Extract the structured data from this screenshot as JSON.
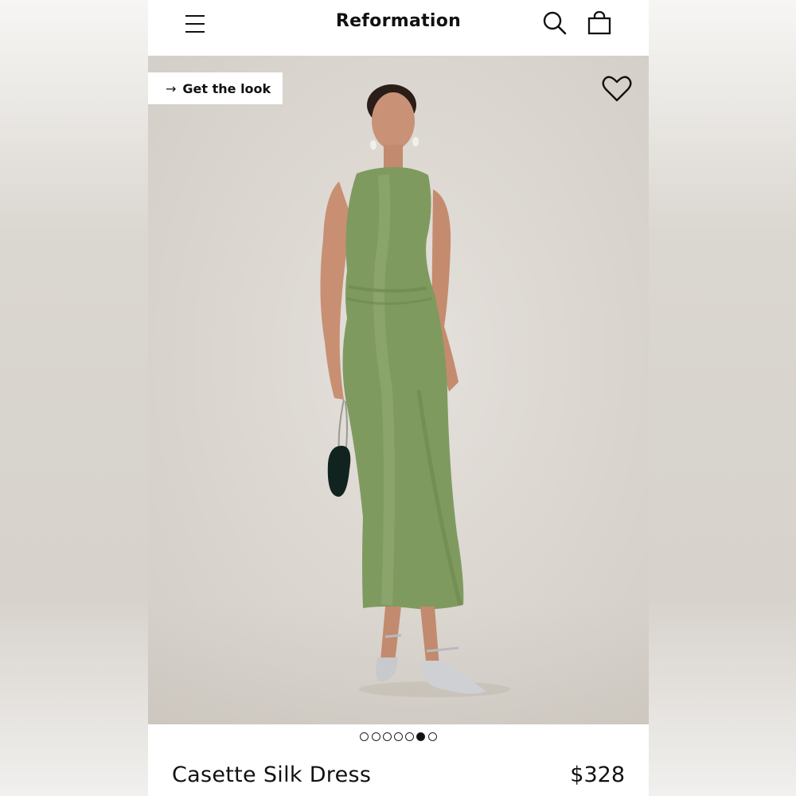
{
  "header": {
    "brand": "Reformation",
    "menu_icon": "hamburger-menu-icon",
    "search_icon": "search-icon",
    "bag_icon": "shopping-bag-icon"
  },
  "hero": {
    "get_the_look_label": "Get the look",
    "get_the_look_icon": "arrow-right-icon",
    "wishlist_icon": "heart-icon",
    "dress_color": "#7f9a5f"
  },
  "gallery": {
    "total_images": 7,
    "active_index": 6
  },
  "product": {
    "name": "Casette Silk Dress",
    "price": "$328"
  }
}
